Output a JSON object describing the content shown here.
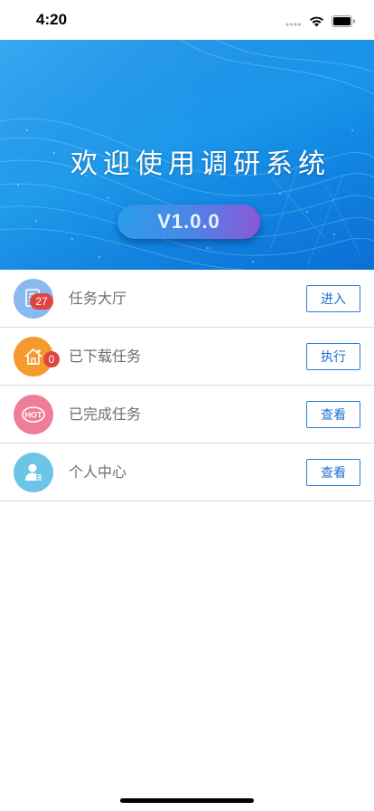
{
  "status_bar": {
    "time": "4:20",
    "icons": [
      "cellular-icon",
      "wifi-icon",
      "battery-icon"
    ]
  },
  "banner": {
    "title": "欢迎使用调研系统",
    "version": "V1.0.0"
  },
  "menu": [
    {
      "label": "任务大厅",
      "action": "进入",
      "badge": "27",
      "icon": "task-list-icon",
      "icon_color": "#8ab8f0"
    },
    {
      "label": "已下载任务",
      "action": "执行",
      "badge": "0",
      "icon": "home-heart-icon",
      "icon_color": "#f59a2e"
    },
    {
      "label": "已完成任务",
      "action": "查看",
      "badge": "",
      "icon": "hot-icon",
      "icon_color": "#ef7d98"
    },
    {
      "label": "个人中心",
      "action": "查看",
      "badge": "",
      "icon": "person-icon",
      "icon_color": "#6cc4e6"
    }
  ],
  "colors": {
    "accent": "#2a7ed8",
    "badge": "#e0443e",
    "banner": "#1196ec"
  }
}
